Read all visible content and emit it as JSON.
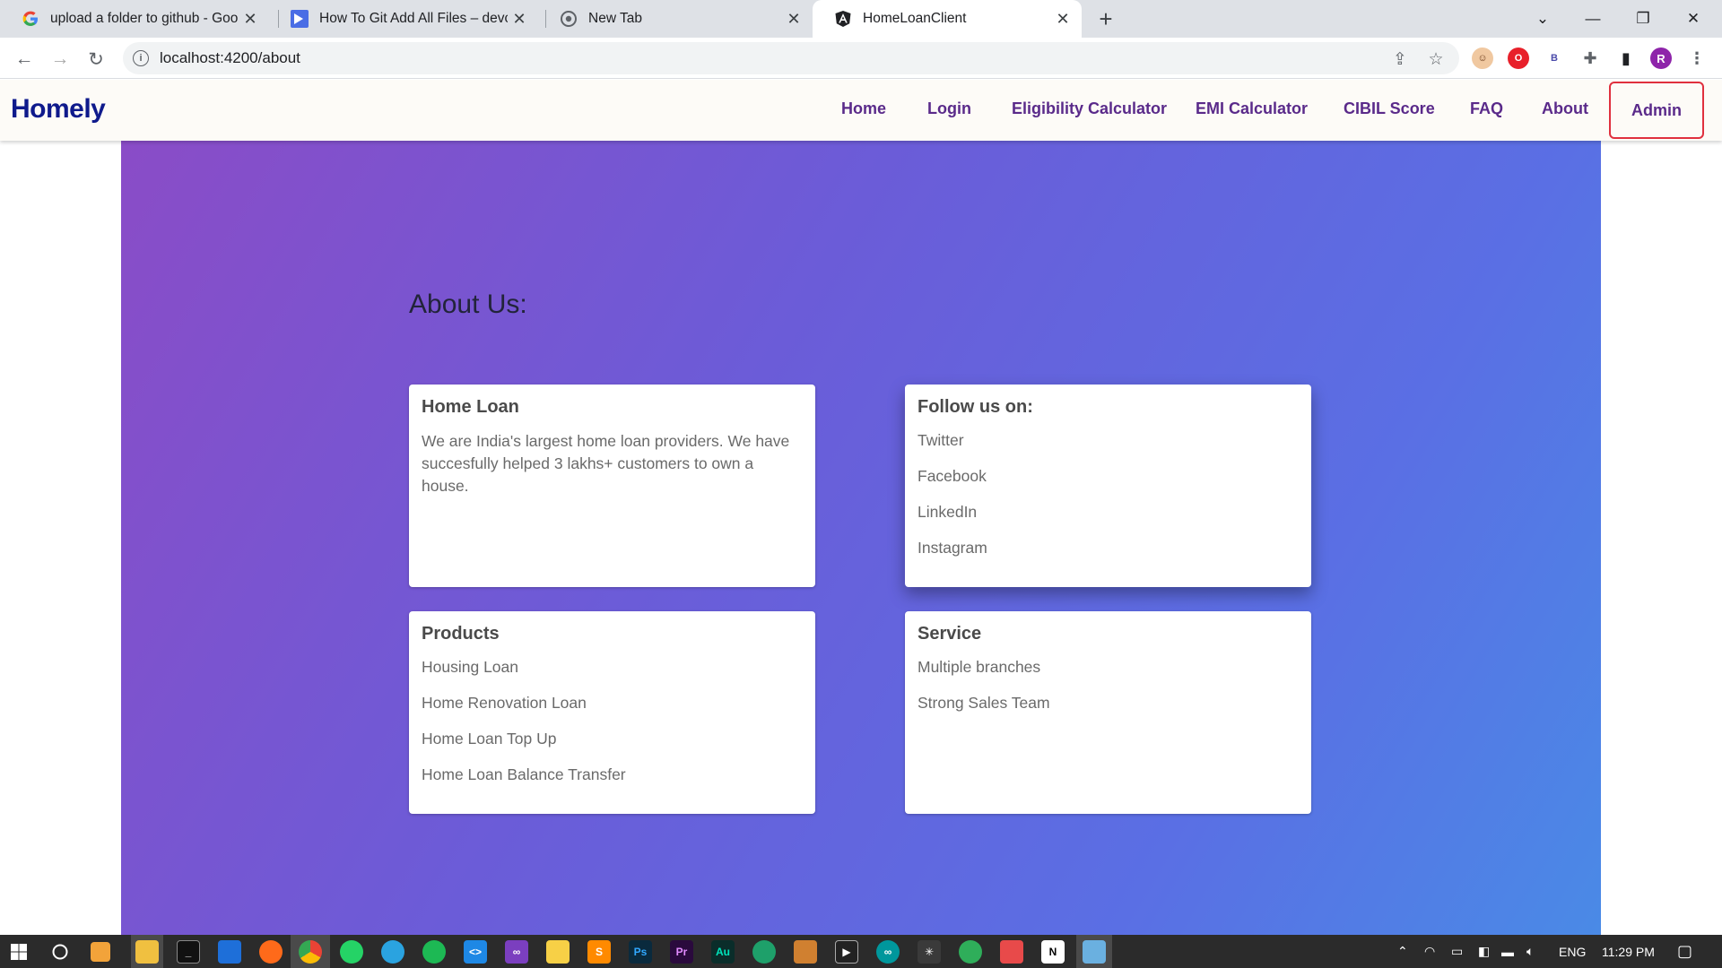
{
  "browser": {
    "tabs": [
      {
        "title": "upload a folder to github - Goog",
        "icon": "google-icon"
      },
      {
        "title": "How To Git Add All Files – devcor",
        "icon": "devconnected-icon"
      },
      {
        "title": "New Tab",
        "icon": "chrome-icon"
      },
      {
        "title": "HomeLoanClient",
        "icon": "angular-icon",
        "active": true
      }
    ],
    "url": "localhost:4200/about",
    "profile_initial": "R",
    "ext_b": "B"
  },
  "site": {
    "brand": "Homely",
    "nav": [
      "Home",
      "Login",
      "Eligibility Calculator",
      "EMI Calculator",
      "CIBIL Score",
      "FAQ",
      "About",
      "Admin"
    ],
    "highlighted_nav": "Admin",
    "highlight_color": "#e0303e"
  },
  "about": {
    "title": "About Us:",
    "home_loan": {
      "heading": "Home Loan",
      "text": "We are India's largest home loan providers. We have succesfully helped 3 lakhs+ customers to own a house."
    },
    "follow": {
      "heading": "Follow us on:",
      "items": [
        "Twitter",
        "Facebook",
        "LinkedIn",
        "Instagram"
      ]
    },
    "products": {
      "heading": "Products",
      "items": [
        "Housing Loan",
        "Home Renovation Loan",
        "Home Loan Top Up",
        "Home Loan Balance Transfer"
      ]
    },
    "service": {
      "heading": "Service",
      "items": [
        "Multiple branches",
        "Strong Sales Team"
      ]
    }
  },
  "taskbar": {
    "language": "ENG",
    "time": "11:29 PM"
  },
  "colors": {
    "brand": "#0f1a8c",
    "nav_text": "#5a2a8a",
    "gradient_start": "#8a4cc7",
    "gradient_end": "#4a8ae6"
  }
}
